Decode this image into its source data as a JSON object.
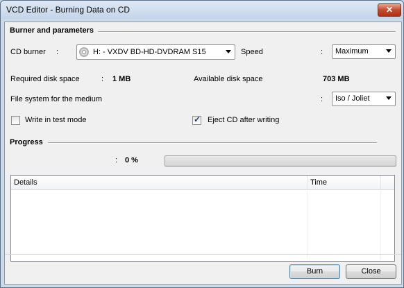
{
  "window": {
    "title": "VCD Editor - Burning Data on CD",
    "close_label": "✕"
  },
  "burner_section": {
    "heading": "Burner and parameters",
    "cd_burner_label": "CD burner",
    "colon": ":",
    "cd_burner_value": "H: - VXDV     BD-HD-DVDRAM S15",
    "speed_label": "Speed",
    "speed_value": "Maximum",
    "required_space_label": "Required disk space",
    "required_space_value": "1 MB",
    "available_space_label": "Available disk space",
    "available_space_value": "703 MB",
    "filesystem_label": "File system for the medium",
    "filesystem_value": "Iso / Joliet",
    "test_mode_label": "Write in test mode",
    "test_mode_checked": false,
    "eject_label": "Eject CD after writing",
    "eject_checked": true
  },
  "progress_section": {
    "heading": "Progress",
    "percent_text": "0 %",
    "progress_value": 0
  },
  "details_list": {
    "columns": [
      "Details",
      "Time"
    ],
    "rows": []
  },
  "buttons": {
    "burn": "Burn",
    "close": "Close"
  },
  "icons": {
    "cd_icon": "cd-disc-icon",
    "dropdown": "chevron-down-icon",
    "check": "checkmark-icon"
  }
}
